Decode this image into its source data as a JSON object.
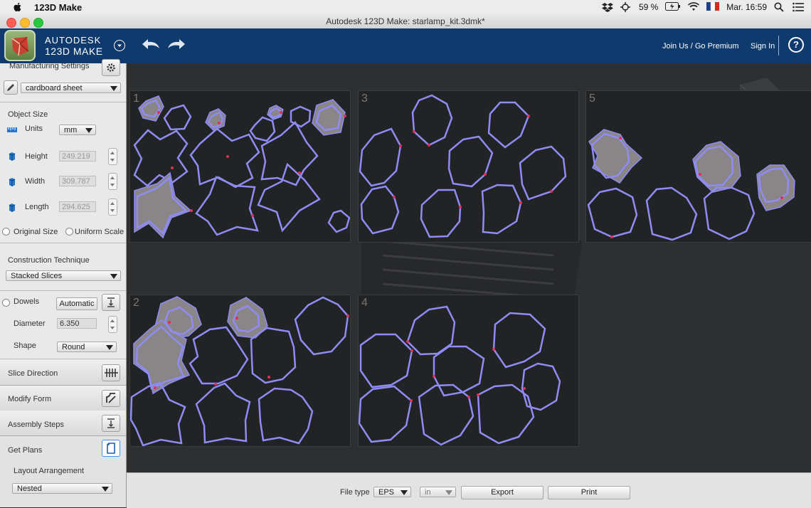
{
  "menubar": {
    "app_name": "123D Make",
    "battery": "59 %",
    "clock": "Mar. 16:59"
  },
  "window": {
    "title": "Autodesk 123D Make: starlamp_kit.3dmk*"
  },
  "header": {
    "brand_line1": "AUTODESK",
    "brand_line2": "123D MAKE",
    "join_label": "Join Us / Go Premium",
    "signin_label": "Sign In",
    "help_label": "?"
  },
  "panel": {
    "manufacturing_settings": "Manufacturing Settings",
    "material": "cardboard sheet",
    "object_size": "Object Size",
    "units_label": "Units",
    "units_value": "mm",
    "height_label": "Height",
    "height_value": "249.219",
    "width_label": "Width",
    "width_value": "309.787",
    "length_label": "Length",
    "length_value": "294.625",
    "original_size": "Original Size",
    "uniform_scale": "Uniform Scale",
    "construction_label": "Construction Technique",
    "construction_value": "Stacked Slices",
    "dowels_label": "Dowels",
    "dowels_button": "Automatic",
    "diameter_label": "Diameter",
    "diameter_value": "6.350",
    "shape_label": "Shape",
    "shape_value": "Round",
    "slice_direction": "Slice Direction",
    "modify_form": "Modify Form",
    "assembly_steps": "Assembly Steps",
    "get_plans": "Get Plans",
    "layout_label": "Layout Arrangement",
    "layout_value": "Nested"
  },
  "sheets": [
    {
      "number": "1"
    },
    {
      "number": "2"
    },
    {
      "number": "3"
    },
    {
      "number": "4"
    },
    {
      "number": "5"
    }
  ],
  "bottom": {
    "file_type_label": "File type",
    "file_type_value": "EPS",
    "unit_value": "in",
    "export_label": "Export",
    "print_label": "Print"
  },
  "colors": {
    "header_bg": "#0f3a6e",
    "outline": "#8f8cf5",
    "notch": "#e0305a"
  }
}
